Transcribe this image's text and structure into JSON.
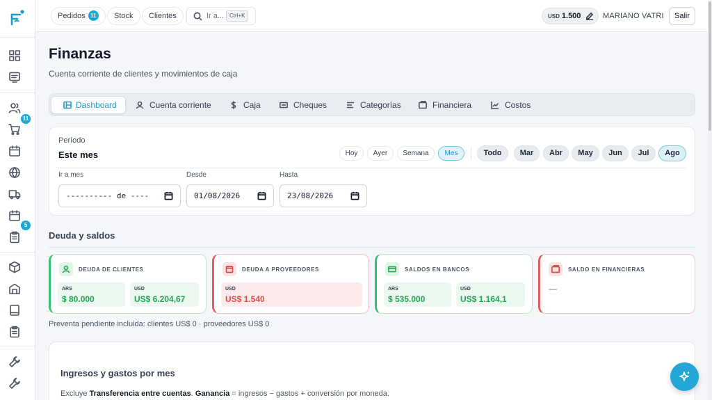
{
  "topbar": {
    "pedidos_label": "Pedidos",
    "pedidos_badge": "11",
    "stock_label": "Stock",
    "clientes_label": "Clientes",
    "search_placeholder": "Ir a...",
    "search_shortcut": "Ctrl+K",
    "currency_code": "USD",
    "currency_rate": "1.500",
    "user_name": "MARIANO VATRI",
    "logout_label": "Salir"
  },
  "sidebar": {
    "cart_badge": "11",
    "calendar_badge": "5",
    "icons": [
      "grid-icon",
      "list-icon",
      "users-icon",
      "cart-icon",
      "calendar-icon",
      "globe-icon",
      "truck-icon",
      "calendar-icon",
      "clipboard-icon",
      "box-icon",
      "warehouse-icon",
      "book-icon",
      "clipboard-icon",
      "wrench-icon",
      "wrench-icon"
    ]
  },
  "page": {
    "title": "Finanzas",
    "subtitle": "Cuenta corriente de clientes y movimientos de caja"
  },
  "tabs": [
    {
      "label": "Dashboard",
      "icon": "layout-icon",
      "active": true
    },
    {
      "label": "Cuenta corriente",
      "icon": "user-icon"
    },
    {
      "label": "Caja",
      "icon": "dollar-icon"
    },
    {
      "label": "Cheques",
      "icon": "card-icon"
    },
    {
      "label": "Categorías",
      "icon": "lines-icon"
    },
    {
      "label": "Financiera",
      "icon": "wallet-icon"
    },
    {
      "label": "Costos",
      "icon": "chart-line-icon"
    }
  ],
  "period": {
    "label": "Período",
    "value": "Este mes",
    "quick": [
      "Hoy",
      "Ayer",
      "Semana",
      "Mes"
    ],
    "quick_active": "Mes",
    "months": [
      "Todo",
      "Mar",
      "Abr",
      "May",
      "Jun",
      "Jul",
      "Ago"
    ],
    "month_active": "Ago",
    "goto_label": "Ir a mes",
    "goto_value": "---------- de ----",
    "from_label": "Desde",
    "from_value": "01/08/2026",
    "to_label": "Hasta",
    "to_value": "23/08/2026"
  },
  "debt": {
    "title": "Deuda y saldos",
    "cards": [
      {
        "title": "DEUDA DE CLIENTES",
        "k1": "ARS",
        "v1": "$ 80.000",
        "k2": "USD",
        "v2": "US$ 6.204,67",
        "color": "#34c26a"
      },
      {
        "title": "DEUDA A PROVEEDORES",
        "k1": "USD",
        "v1": "US$ 1.540",
        "color": "#e35b5b"
      },
      {
        "title": "SALDOS EN BANCOS",
        "k1": "ARS",
        "v1": "$ 535.000",
        "k2": "USD",
        "v2": "US$ 1.164,1",
        "color": "#34c26a"
      },
      {
        "title": "SALDO EN FINANCIERAS",
        "empty": "—",
        "color": "#e35b5b"
      }
    ],
    "note": "Preventa pendiente incluida: clientes US$ 0 · proveedores US$ 0"
  },
  "chart_section": {
    "title": "Ingresos y gastos por mes",
    "note_prefix": "Excluye ",
    "note_bold1": "Transferencia entre cuentas",
    "note_mid": ". ",
    "note_bold2": "Ganancia",
    "note_suffix": " = ingresos − gastos + conversión por moneda."
  }
}
